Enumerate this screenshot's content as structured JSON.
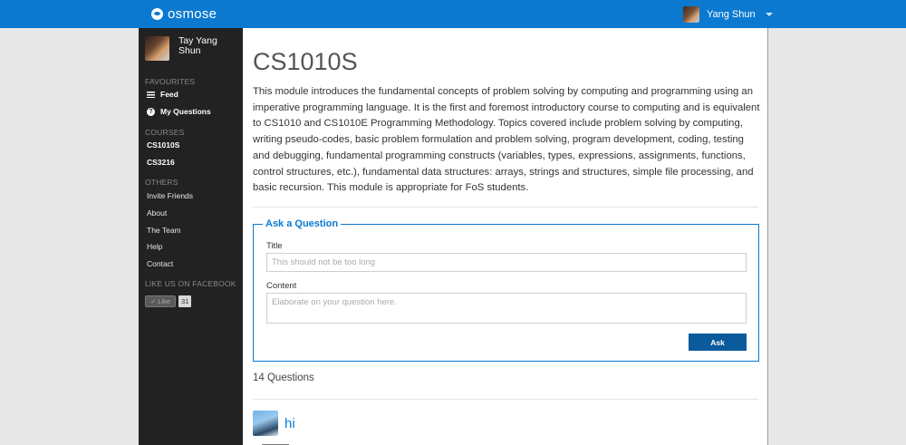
{
  "topbar": {
    "logo_text": "osmose",
    "user_name": "Yang Shun",
    "brand_color": "#0b79d0"
  },
  "sidebar": {
    "profile_name": "Tay Yang Shun",
    "favourites_heading": "FAVOURITES",
    "favourites": [
      {
        "label": "Feed",
        "icon": "list-icon"
      },
      {
        "label": "My Questions",
        "icon": "question-icon"
      }
    ],
    "courses_heading": "COURSES",
    "courses": [
      {
        "label": "CS1010S"
      },
      {
        "label": "CS3216"
      }
    ],
    "others_heading": "OTHERS",
    "others": [
      {
        "label": "Invite Friends"
      },
      {
        "label": "About"
      },
      {
        "label": "The Team"
      },
      {
        "label": "Help"
      },
      {
        "label": "Contact"
      }
    ],
    "facebook_heading": "LIKE US ON FACEBOOK",
    "like_label": "Like",
    "like_count": "31"
  },
  "main": {
    "course_title": "CS1010S",
    "course_description": "This module introduces the fundamental concepts of problem solving by computing and programming using an imperative programming language. It is the first and foremost introductory course to computing and is equivalent to CS1010 and CS1010E Programming Methodology. Topics covered include problem solving by computing, writing pseudo-codes, basic problem formulation and problem solving, program development, coding, testing and debugging, fundamental programming constructs (variables, types, expressions, assignments, functions, control structures, etc.), fundamental data structures: arrays, strings and structures, simple file processing, and basic recursion. This module is appropriate for FoS students.",
    "ask": {
      "legend": "Ask a Question",
      "title_label": "Title",
      "title_placeholder": "This should not be too long",
      "title_value": "",
      "content_label": "Content",
      "content_placeholder": "Elaborate on your question here.",
      "content_value": "",
      "button_label": "Ask"
    },
    "question_count": "14 Questions",
    "questions": [
      {
        "title": "hi"
      }
    ]
  }
}
